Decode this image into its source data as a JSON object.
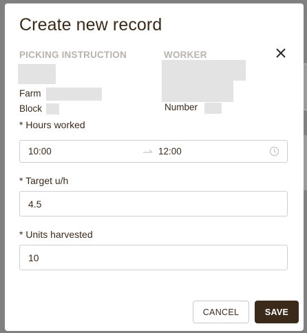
{
  "modal": {
    "title": "Create new record",
    "close_icon": "close-icon"
  },
  "picking_instruction": {
    "heading": "PICKING INSTRUCTION",
    "farm_label": "Farm",
    "block_label": "Block"
  },
  "worker": {
    "heading": "WORKER",
    "number_label": "Number"
  },
  "hours_worked": {
    "label": "* Hours worked",
    "from": "10:00",
    "to": "12:00",
    "arrow_icon": "arrow-right-icon",
    "clock_icon": "clock-icon"
  },
  "target_uh": {
    "label": "* Target u/h",
    "value": "4.5"
  },
  "units_harvested": {
    "label": "* Units harvested",
    "value": "10"
  },
  "actions": {
    "cancel_label": "CANCEL",
    "save_label": "SAVE"
  },
  "colors": {
    "primary_brown": "#3b2a1a",
    "text_brown": "#3a2a1c",
    "section_label_gray": "#b8b3ad",
    "placeholder_gray": "#e3e3e3",
    "overlay": "#808080"
  }
}
